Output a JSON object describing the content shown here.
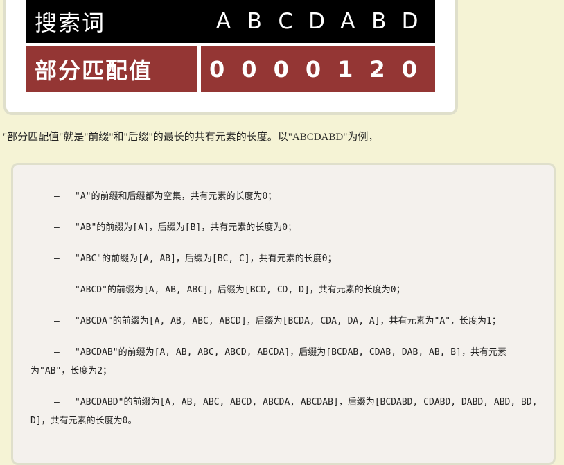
{
  "table": {
    "header_label": "搜索词",
    "header_cells": [
      "A",
      "B",
      "C",
      "D",
      "A",
      "B",
      "D"
    ],
    "value_label": "部分匹配值",
    "value_cells": [
      "0",
      "0",
      "0",
      "0",
      "1",
      "2",
      "0"
    ]
  },
  "paragraph": "\"部分匹配值\"就是\"前缀\"和\"后缀\"的最长的共有元素的长度。以\"ABCDABD\"为例，",
  "list": [
    "\"A\"的前缀和后缀都为空集，共有元素的长度为0；",
    "\"AB\"的前缀为[A]，后缀为[B]，共有元素的长度为0；",
    "\"ABC\"的前缀为[A, AB]，后缀为[BC, C]，共有元素的长度0；",
    "\"ABCD\"的前缀为[A, AB, ABC]，后缀为[BCD, CD, D]，共有元素的长度为0；",
    "\"ABCDA\"的前缀为[A, AB, ABC, ABCD]，后缀为[BCDA, CDA, DA, A]，共有元素为\"A\"，长度为1；",
    "\"ABCDAB\"的前缀为[A, AB, ABC, ABCD, ABCDA]，后缀为[BCDAB, CDAB, DAB, AB, B]，共有元素为\"AB\"，长度为2；",
    "\"ABCDABD\"的前缀为[A, AB, ABC, ABCD, ABCDA, ABCDAB]，后缀为[BCDABD, CDABD, DABD, ABD, BD, D]，共有元素的长度为0。"
  ],
  "dash": "–"
}
